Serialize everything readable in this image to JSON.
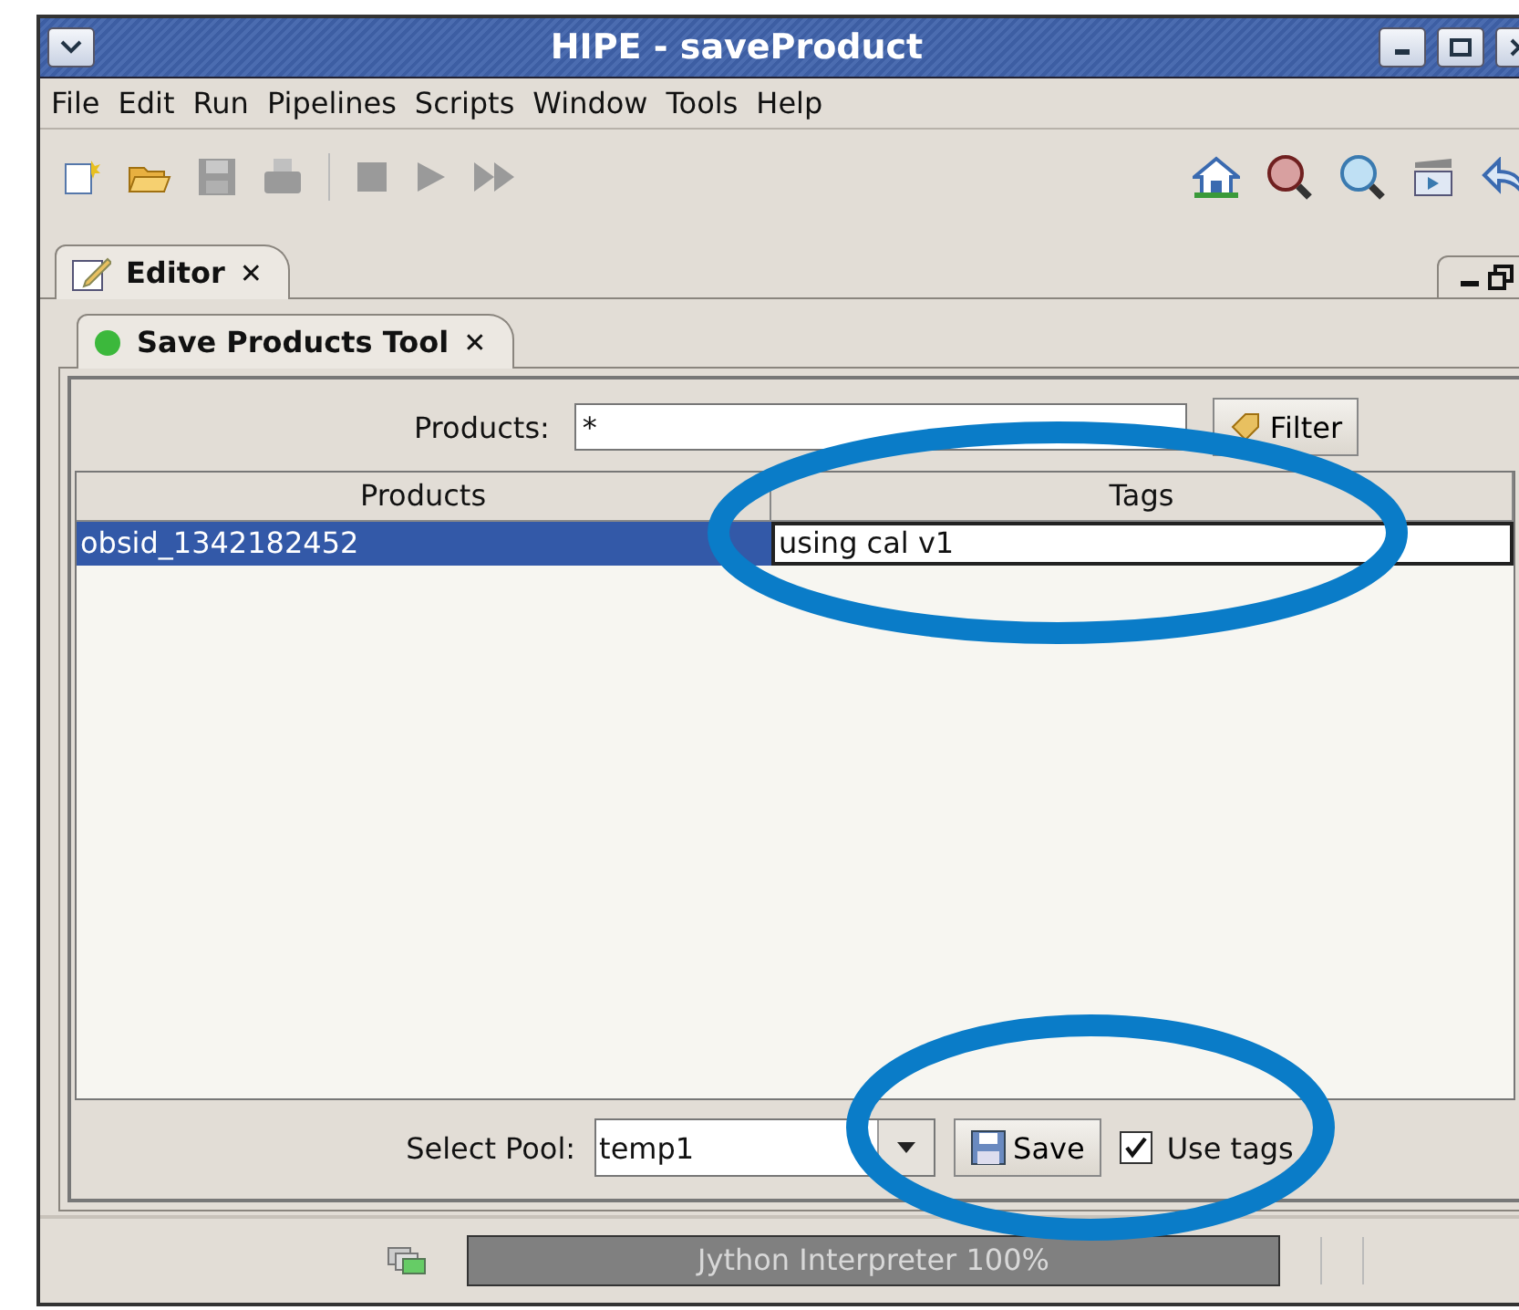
{
  "window": {
    "title": "HIPE - saveProduct"
  },
  "menu": [
    "File",
    "Edit",
    "Run",
    "Pipelines",
    "Scripts",
    "Window",
    "Tools",
    "Help"
  ],
  "editor_tab": {
    "label": "Editor",
    "close": "✕",
    "selected": true
  },
  "tool_tab": {
    "label": "Save Products Tool",
    "close": "✕",
    "selected": true
  },
  "filter": {
    "label": "Products:",
    "value": "*",
    "button": "Filter"
  },
  "table": {
    "columns": [
      "Products",
      "Tags"
    ],
    "rows": [
      {
        "cells": [
          "obsid_1342182452",
          "using cal v1"
        ],
        "selected": true
      }
    ]
  },
  "pool": {
    "label": "Select Pool:",
    "value": "temp1",
    "save": "Save",
    "use_tags": {
      "label": "Use tags",
      "checked": true
    }
  },
  "status_bar": {
    "progress": {
      "text": "Jython Interpreter 100%",
      "level": 1
    }
  }
}
